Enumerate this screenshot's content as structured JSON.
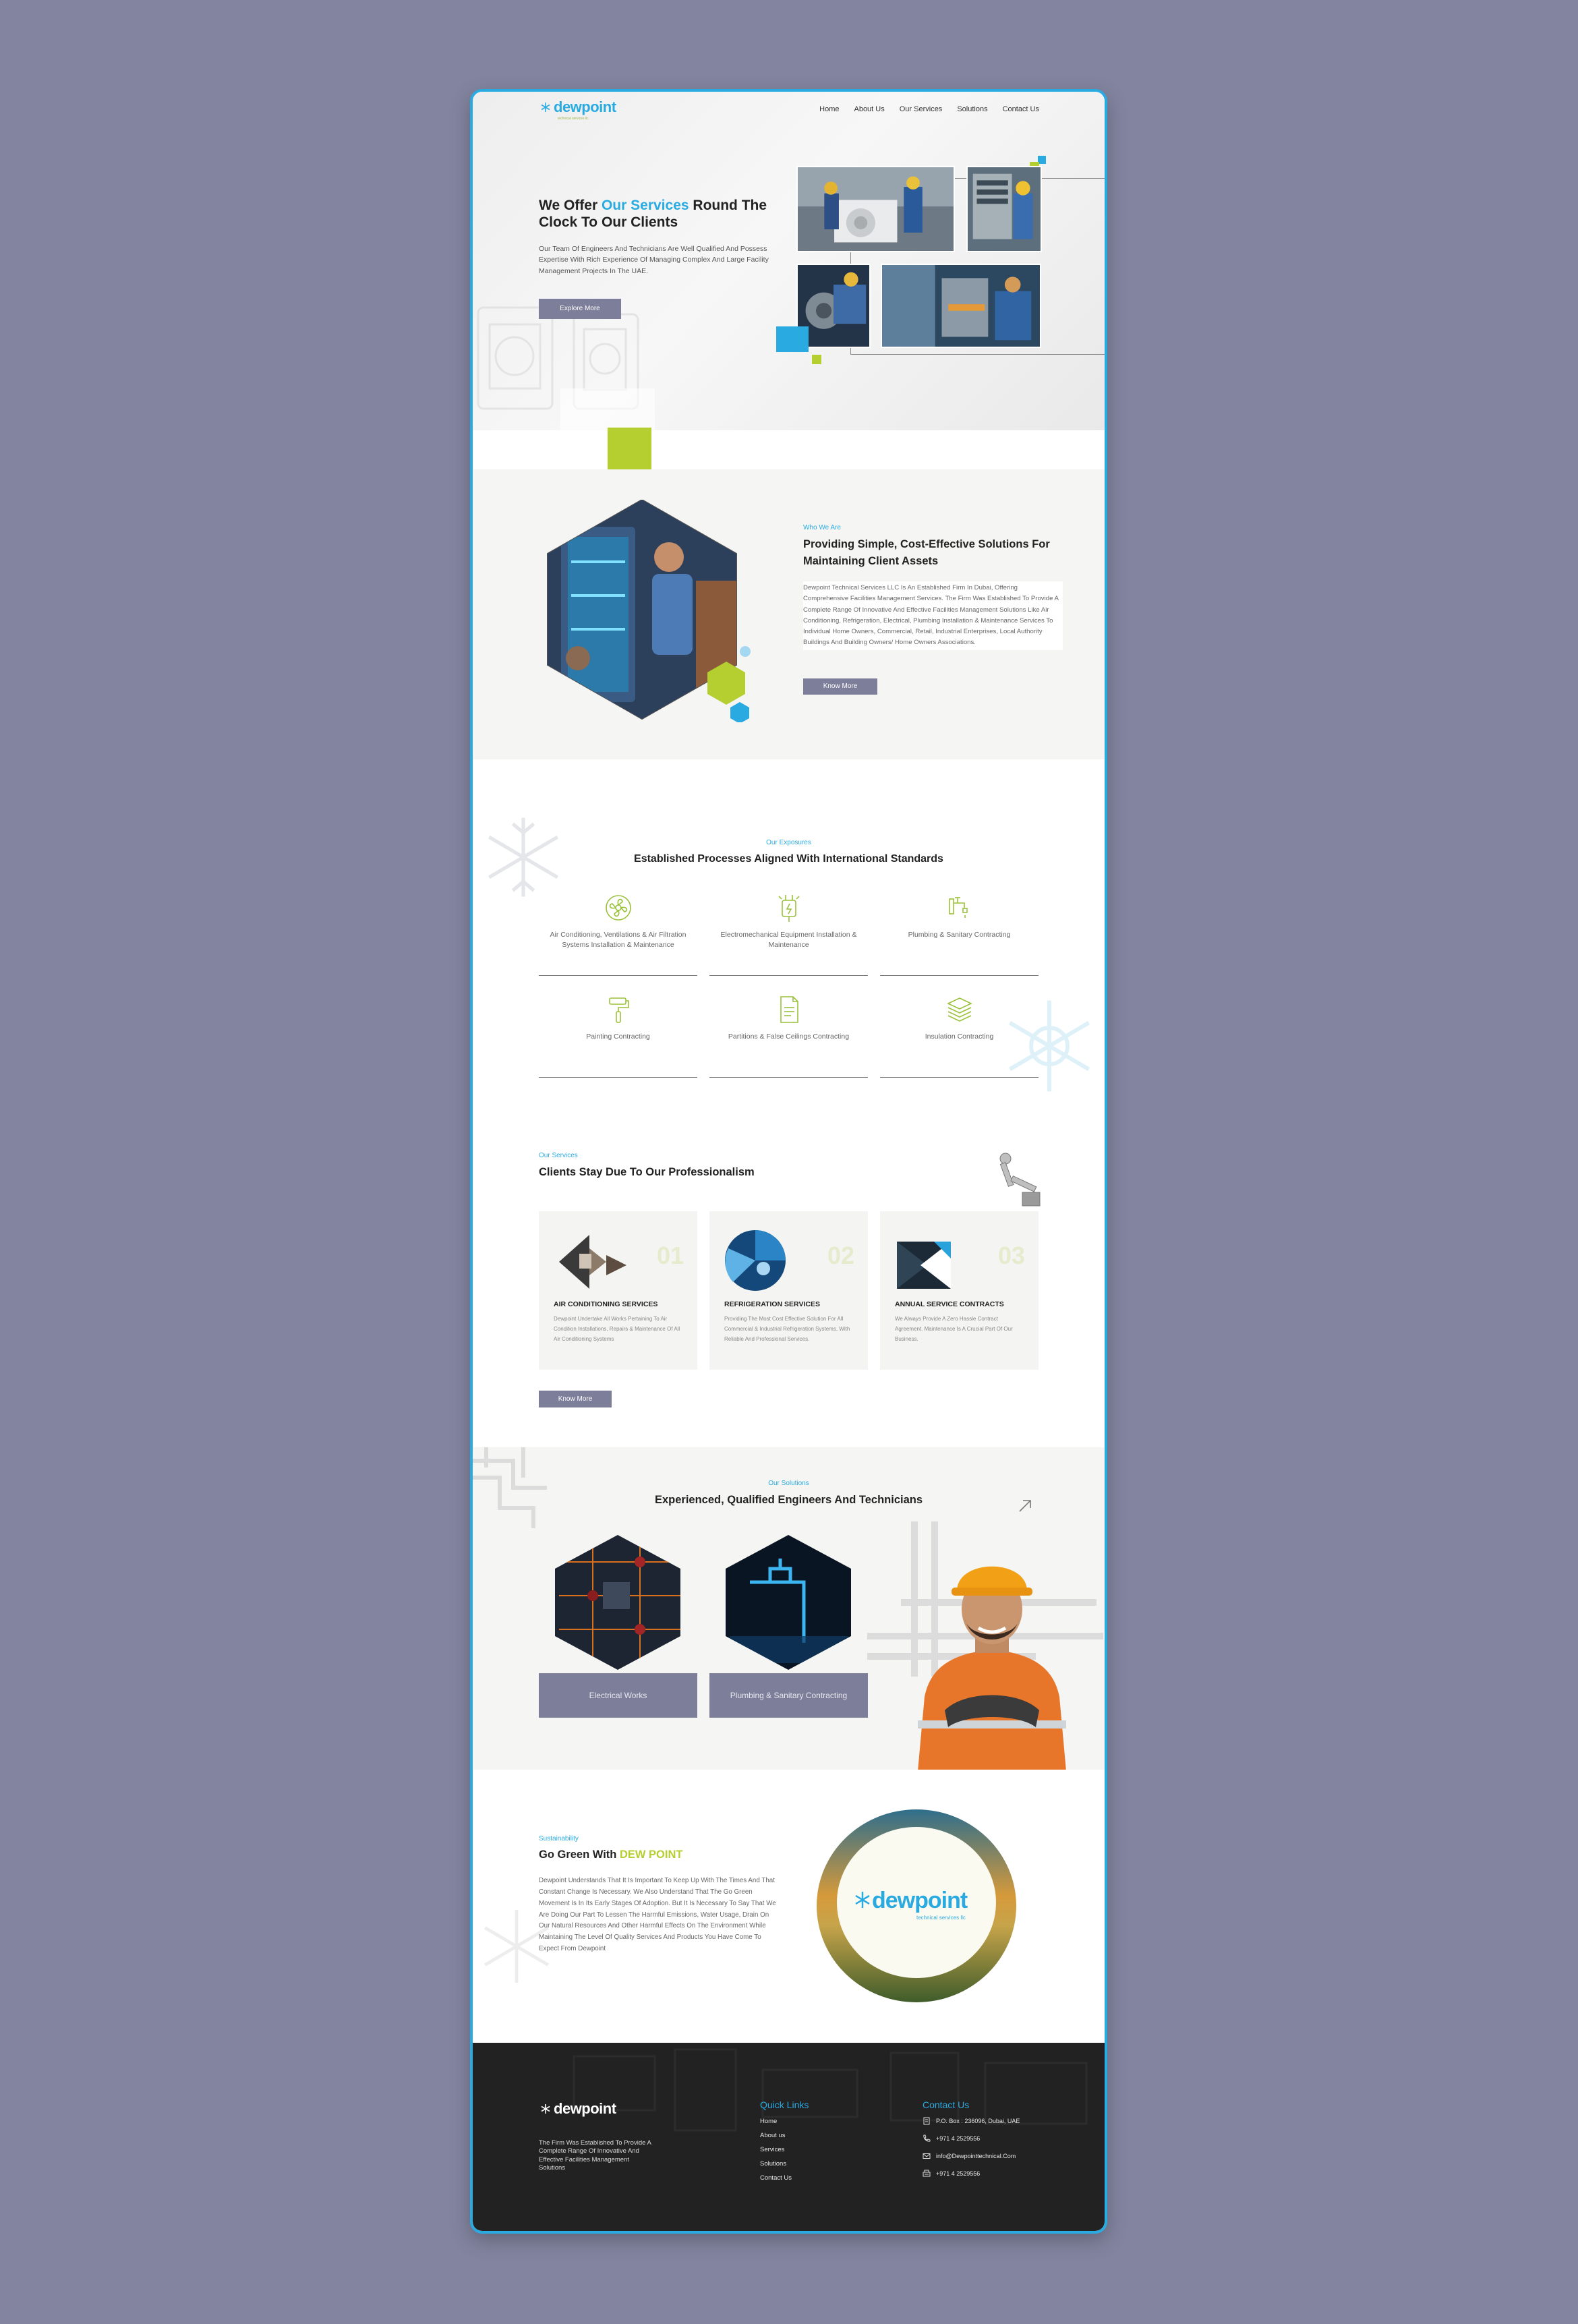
{
  "header": {
    "logo_text": "dewpoint",
    "logo_sub": "technical services llc",
    "nav": [
      "Home",
      "About Us",
      "Our Services",
      "Solutions",
      "Contact Us"
    ]
  },
  "hero": {
    "title_pre": "We Offer ",
    "title_highlight": "Our Services",
    "title_post": " Round The Clock To Our Clients",
    "text": "Our  Team Of Engineers And Technicians Are Well Qualified And Possess Expertise With Rich Experience Of Managing Complex And Large Facility Management Projects In The UAE.",
    "button": "Explore More"
  },
  "who": {
    "tag": "Who We Are",
    "title": "Providing Simple, Cost-Effective Solutions For Maintaining Client Assets",
    "text": "Dewpoint Technical Services LLC Is An Established Firm In  Dubai, Offering Comprehensive Facilities Management  Services. The Firm Was Established To Provide A Complete  Range Of Innovative And Effective Facilities  Management Solutions Like Air Conditioning, Refrigeration, Electrical, Plumbing Installation &  Maintenance Services To Individual Home Owners,  Commercial, Retail, Industrial Enterprises, Local Authority  Buildings And Building Owners/ Home Owners  Associations.",
    "button": "Know More"
  },
  "exposures": {
    "tag": "Our Exposures",
    "title": "Established Processes Aligned With International Standards",
    "items": [
      {
        "label": "Air Conditioning, Ventilations & Air Filtration Systems Installation & Maintenance",
        "icon": "ac-fan-icon"
      },
      {
        "label": "Electromechanical Equipment Installation & Maintenance",
        "icon": "electromechanical-icon"
      },
      {
        "label": "Plumbing & Sanitary Contracting",
        "icon": "faucet-icon"
      },
      {
        "label": "Painting Contracting",
        "icon": "paint-roller-icon"
      },
      {
        "label": "Partitions & False Ceilings Contracting",
        "icon": "document-icon"
      },
      {
        "label": "Insulation Contracting",
        "icon": "layers-icon"
      }
    ]
  },
  "services": {
    "tag": "Our Services",
    "title": "Clients Stay Due To Our Professionalism",
    "cards": [
      {
        "num": "01",
        "title": "AIR CONDITIONING SERVICES",
        "text": "Dewpoint Undertake All Works Pertaining To Air Condition Installations, Repairs & Maintenance Of All Air Conditioning Systems"
      },
      {
        "num": "02",
        "title": "REFRIGERATION SERVICES",
        "text": "Providing The Most Cost Effective Solution For All Commercial & Industrial  Refrigeration Systems, With Reliable And Professional Services."
      },
      {
        "num": "03",
        "title": "ANNUAL SERVICE CONTRACTS",
        "text": "We Always Provide A Zero Hassle Contract Agreement. Maintenance Is A Crucial Part Of Our Business."
      }
    ],
    "button": "Know More"
  },
  "solutions": {
    "tag": "Our Solutions",
    "title": "Experienced, Qualified Engineers And Technicians",
    "items": [
      "Electrical Works",
      "Plumbing & Sanitary Contracting"
    ]
  },
  "sustainability": {
    "tag": "Sustainability",
    "title_pre": "Go Green With ",
    "title_highlight": "DEW POINT",
    "text": "Dewpoint Understands That It Is Important  To Keep Up With The Times And That Constant  Change Is Necessary. We Also Understand That  The Go Green Movement Is In Its Early Stages Of  Adoption. But It Is Necessary To Say That We Are  Doing Our Part To Lessen The Harmful Emissions, Water Usage, Drain On Our Natural  Resources And Other Harmful Effects On  The Environment While Maintaining The Level Of Quality Services And  Products You Have Come To Expect From Dewpoint",
    "logo_text": "dewpoint",
    "logo_sub": "technical services llc"
  },
  "footer": {
    "logo_text": "dewpoint",
    "description": "The Firm Was Established To Provide A Complete  Range Of Innovative And Effective Facilities  Management Solutions",
    "quick_links_title": "Quick Links",
    "quick_links": [
      "Home",
      "About us",
      "Services",
      "Solutions",
      "Contact Us"
    ],
    "contact_title": "Contact Us",
    "contact": [
      {
        "icon": "building-icon",
        "text": "P.O. Box : 236096, Dubai, UAE"
      },
      {
        "icon": "phone-icon",
        "text": "+971 4 2529556"
      },
      {
        "icon": "mail-icon",
        "text": "info@Dewpointtechnical.Com"
      },
      {
        "icon": "fax-icon",
        "text": "+971 4 2529556"
      }
    ]
  },
  "colors": {
    "accent_blue": "#29abe2",
    "accent_green": "#b4cf2f",
    "button": "#7c7e9a",
    "footer_bg": "#232222",
    "page_bg": "#8385a0"
  }
}
